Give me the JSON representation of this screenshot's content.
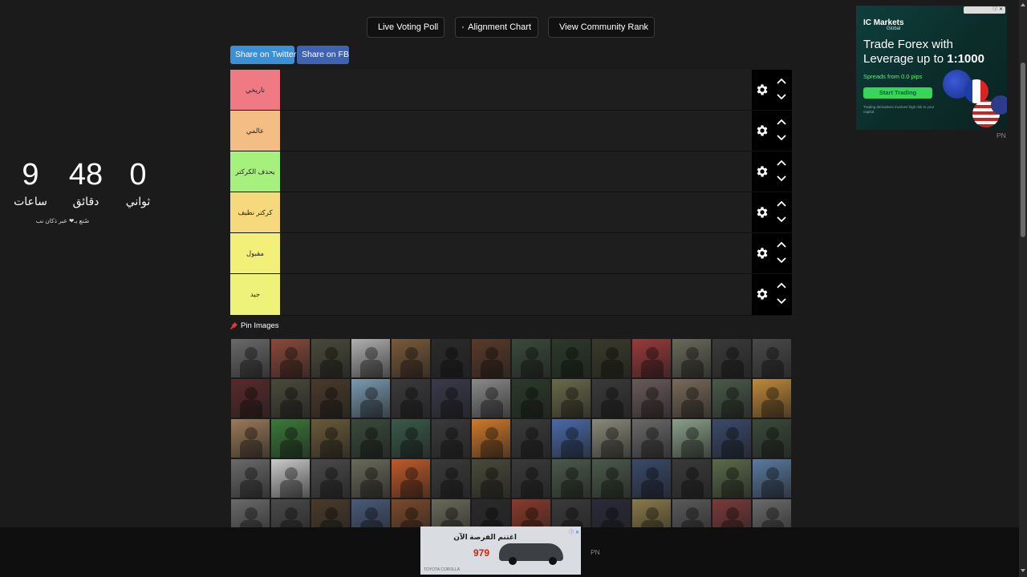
{
  "toolbar": {
    "live_poll": "Live Voting Poll",
    "alignment": "Alignment Chart",
    "community": "View Community Rank"
  },
  "share": {
    "twitter": "Share on Twitter",
    "facebook": "Share on FB"
  },
  "tiers": [
    {
      "label": "تاريخي",
      "color": "#f07a84"
    },
    {
      "label": "عالمي",
      "color": "#f4bd84"
    },
    {
      "label": "يحذف الكركتر",
      "color": "#a6f07d"
    },
    {
      "label": "كركتر نظيف",
      "color": "#f5d97c"
    },
    {
      "label": "مقبول",
      "color": "#f3f07a"
    },
    {
      "label": "جيد",
      "color": "#eef279"
    }
  ],
  "countdown": {
    "hours": "9",
    "hours_label": "ساعات",
    "minutes": "48",
    "minutes_label": "دقائق",
    "seconds": "0",
    "seconds_label": "ثواني",
    "credit": "صُنع بـ❤ عبر ذكان نب"
  },
  "pin": {
    "label": "Pin Images"
  },
  "ad_top": {
    "brand": "IC Markets",
    "brand_sub": "Global",
    "headline": "Trade Forex with Leverage up to",
    "headline_strong": "1:1000",
    "sub": "Spreads from 0.0 pips",
    "cta": "Start Trading",
    "fine": "Trading derivatives involves high risk to your capital.",
    "pn": "PN"
  },
  "ad_bottom": {
    "title": "اغتنم الفرصة الآن",
    "price": "979",
    "foot": "TOYOTA COROLLA",
    "pn": "PN"
  },
  "colors": {
    "background": "#1b1b1c",
    "share_twitter": "#3a8fd6",
    "share_fb": "#3f63b3",
    "live_dot": "#e0233a"
  }
}
